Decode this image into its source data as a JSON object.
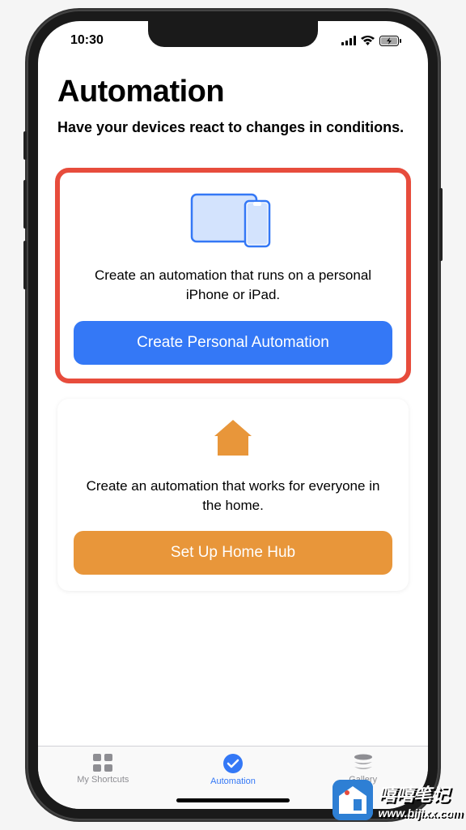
{
  "status_bar": {
    "time": "10:30"
  },
  "header": {
    "title": "Automation",
    "subtitle": "Have your devices react to changes in conditions."
  },
  "cards": {
    "personal": {
      "description": "Create an automation that runs on a personal iPhone or iPad.",
      "button_label": "Create Personal Automation",
      "accent_color": "#3478f6"
    },
    "home": {
      "description": "Create an automation that works for everyone in the home.",
      "button_label": "Set Up Home Hub",
      "accent_color": "#e8963a"
    }
  },
  "tabs": [
    {
      "label": "My Shortcuts",
      "icon": "grid-icon",
      "active": false
    },
    {
      "label": "Automation",
      "icon": "clock-check-icon",
      "active": true
    },
    {
      "label": "Gallery",
      "icon": "stack-icon",
      "active": false
    }
  ],
  "watermark": {
    "title": "嘻嘻笔记",
    "url": "www.bijixx.com"
  }
}
